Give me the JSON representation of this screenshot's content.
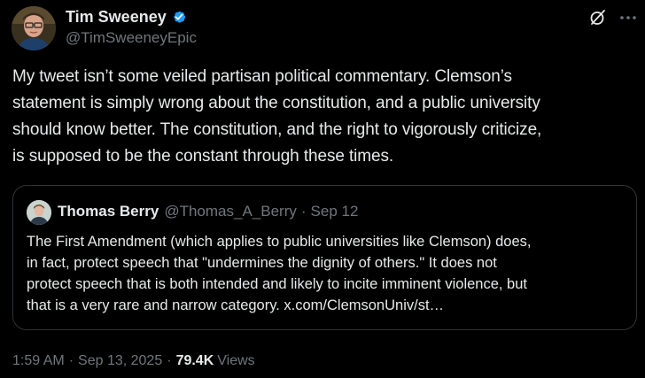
{
  "author": {
    "display_name": "Tim Sweeney",
    "handle": "@TimSweeneyEpic",
    "verified": true,
    "avatar_icon": "profile-photo"
  },
  "actions": {
    "grok_icon": "grok-icon",
    "more_icon": "more-options-icon"
  },
  "tweet": {
    "text": "My tweet isn’t some veiled partisan political commentary. Clemson’s\nstatement is simply wrong about the constitution, and a public university\nshould know better. The constitution, and the right to vigorously criticize,\nis supposed to be the constant through these times."
  },
  "quoted": {
    "display_name": "Thomas Berry",
    "handle": "@Thomas_A_Berry",
    "separator": "·",
    "date": "Sep 12",
    "text": "The First Amendment (which applies to public universities like Clemson) does,\nin fact, protect speech that \"undermines the dignity of others.\" It does not\nprotect speech that is both intended and likely to incite imminent violence, but\nthat is a very rare and narrow category. x.com/ClemsonUniv/st…"
  },
  "meta": {
    "time": "1:59 AM",
    "separator": "·",
    "date": "Sep 13, 2025",
    "views_count": "79.4K",
    "views_label": "Views"
  },
  "colors": {
    "background": "#000000",
    "text_primary": "#e7e9ea",
    "text_secondary": "#71767b",
    "border": "#2f3336",
    "verified_blue": "#1d9bf0"
  }
}
